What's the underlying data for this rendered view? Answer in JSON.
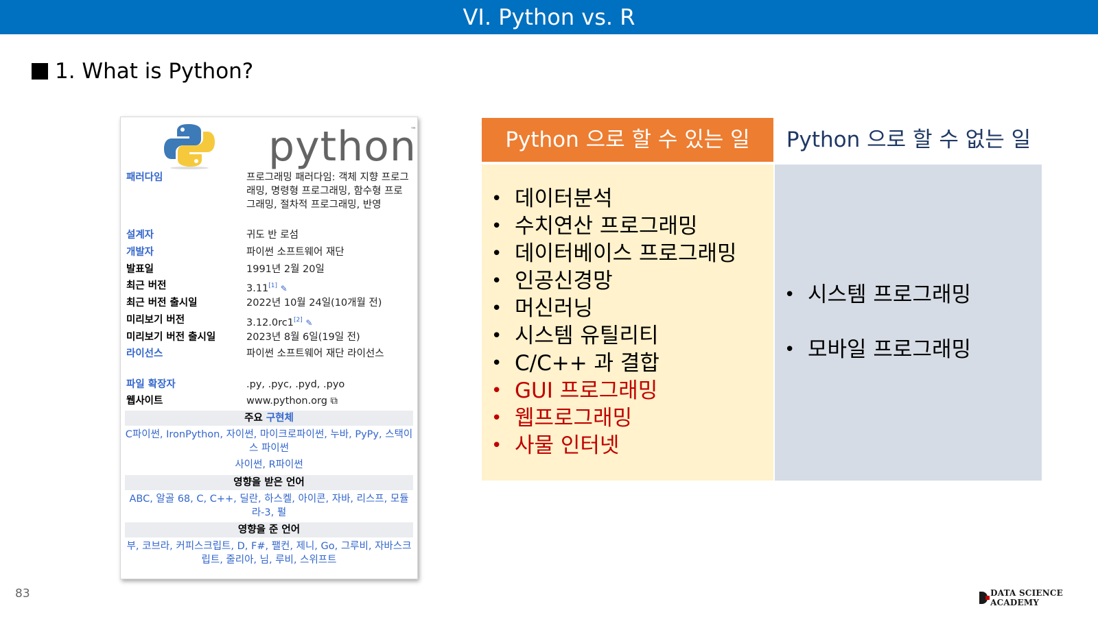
{
  "header": {
    "title": "VI. Python vs. R"
  },
  "section": {
    "title": "1. What is Python?"
  },
  "infobox": {
    "logo_text": "python",
    "logo_tm": "™",
    "rows": [
      {
        "label": "패러다임",
        "value": "프로그래밍 패러다임: 객체 지향 프로그래밍, 명령형 프로그래밍, 함수형 프로그래밍, 절차적 프로그래밍, 반영"
      },
      {
        "label": "설계자",
        "value": "귀도 반 로섬"
      },
      {
        "label": "개발자",
        "value": "파이썬 소프트웨어 재단"
      },
      {
        "label": "발표일",
        "value": "1991년 2월 20일"
      },
      {
        "label": "최근 버전",
        "value": "3.11",
        "sup": "[1]"
      },
      {
        "label": "최근 버전 출시일",
        "value": "2022년 10월 24일(10개월 전)"
      },
      {
        "label": "미리보기 버전",
        "value": "3.12.0rc1",
        "sup": "[2]"
      },
      {
        "label": "미리보기 버전 출시일",
        "value": "2023년 8월 6일(19일 전)"
      },
      {
        "label": "라이선스",
        "value": "파이썬 소프트웨어 재단 라이선스"
      },
      {
        "label": "파일 확장자",
        "value": ".py, .pyc, .pyd, .pyo"
      },
      {
        "label": "웹사이트",
        "value": "www.python.org"
      }
    ],
    "impl_head": {
      "prefix": "주요 ",
      "link": "구현체"
    },
    "impl_list": "C파이썬, IronPython, 자이썬, 마이크로파이썬, 누바, PyPy, 스택이스 파이썬",
    "impl_list2": "사이썬, R파이썬",
    "influenced_by_head": "영향을 받은 언어",
    "influenced_by": "ABC, 알골 68, C, C++, 딜란, 하스켈, 아이콘, 자바, 리스프, 모듈라-3, 펄",
    "influenced_head": "영향을 준 언어",
    "influenced": "부, 코브라, 커피스크립트, D, F#, 팰컨, 제니, Go, 그루비, 자바스크립트, 줄리아, 님, 루비, 스위프트"
  },
  "table": {
    "can_header": "Python 으로 할 수 있는 일",
    "cannot_header": "Python 으로 할 수 없는 일",
    "can_items": [
      {
        "text": "데이터분석",
        "highlight": false
      },
      {
        "text": "수치연산 프로그래밍",
        "highlight": false
      },
      {
        "text": "데이터베이스 프로그래밍",
        "highlight": false
      },
      {
        "text": "인공신경망",
        "highlight": false
      },
      {
        "text": "머신러닝",
        "highlight": false
      },
      {
        "text": "시스템 유틸리티",
        "highlight": false
      },
      {
        "text": "C/C++ 과 결합",
        "highlight": false
      },
      {
        "text": "GUI 프로그래밍",
        "highlight": true
      },
      {
        "text": "웹프로그래밍",
        "highlight": true
      },
      {
        "text": "사물 인터넷",
        "highlight": true
      }
    ],
    "cannot_items": [
      "시스템 프로그래밍",
      "모바일 프로그래밍"
    ]
  },
  "footer": {
    "page_number": "83",
    "brand": "DATA SCIENCE ACADEMY"
  },
  "colors": {
    "header_bg": "#0070c0",
    "can_header_bg": "#ed7d31",
    "can_body_bg": "#fff2cc",
    "cannot_body_bg": "#d6dce5",
    "highlight": "#c00000"
  }
}
